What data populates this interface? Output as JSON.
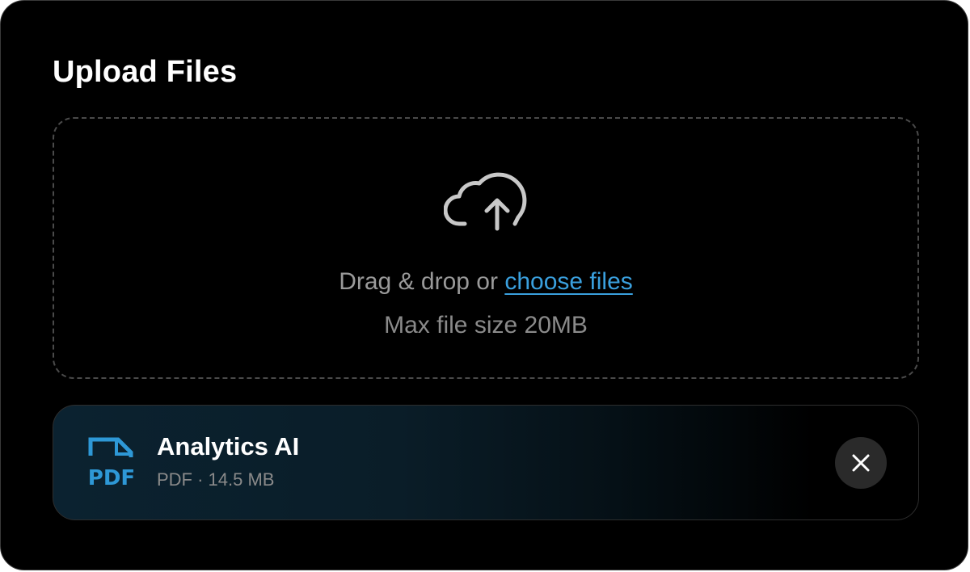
{
  "upload": {
    "title": "Upload Files",
    "drop_text": "Drag & drop or",
    "choose_link": "choose files",
    "max_size": "Max file size 20MB",
    "upload_icon": "cloud-upload-icon"
  },
  "file": {
    "name": "Analytics AI",
    "type_label": "PDF",
    "meta": "PDF · 14.5 MB",
    "type_icon": "pdf-file-icon",
    "remove_icon": "close-icon"
  },
  "colors": {
    "background": "#000000",
    "accent": "#3aa0de",
    "muted_text": "#9a9a9a",
    "border": "#4a4a4a",
    "file_card_gradient_start": "#0b2230"
  }
}
